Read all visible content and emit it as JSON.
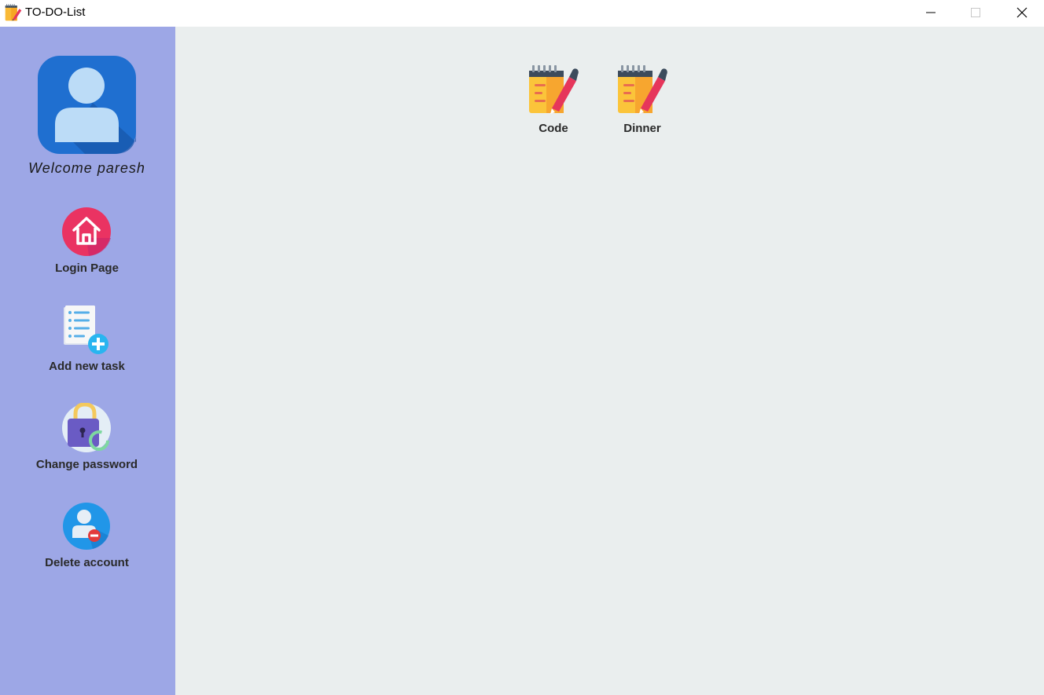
{
  "window": {
    "title": "TO-DO-List",
    "minimize": "minimize",
    "maximize": "maximize",
    "close": "close"
  },
  "sidebar": {
    "welcome": "Welcome paresh",
    "items": [
      {
        "label": "Login Page",
        "icon": "home-icon"
      },
      {
        "label": "Add new task",
        "icon": "add-task-icon"
      },
      {
        "label": "Change password",
        "icon": "lock-refresh-icon"
      },
      {
        "label": "Delete account",
        "icon": "user-remove-icon"
      }
    ]
  },
  "tasks": [
    {
      "label": "Code",
      "icon": "notepad-icon"
    },
    {
      "label": "Dinner",
      "icon": "notepad-icon"
    }
  ],
  "colors": {
    "sidebar_bg": "#9da7e6",
    "main_bg": "#eaeeee",
    "titlebar_bg": "#ffffff"
  }
}
